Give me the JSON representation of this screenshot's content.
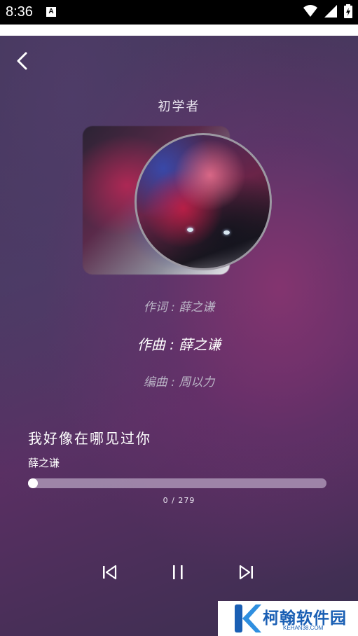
{
  "status_bar": {
    "time": "8:36",
    "notification_icon": "a-icon",
    "icons": [
      "wifi-icon",
      "signal-icon",
      "battery-icon"
    ]
  },
  "player": {
    "album_title": "初学者",
    "lyricist": "作词 : 薛之谦",
    "composer": "作曲 : 薛之谦",
    "arranger": "编曲 : 周以力",
    "song_title": "我好像在哪见过你",
    "artist": "薛之谦",
    "progress": {
      "current": 0,
      "total": 279,
      "label": "0 / 279"
    },
    "controls": [
      "previous-icon",
      "pause-icon",
      "next-icon"
    ]
  },
  "watermark": {
    "name": "柯翰软件园",
    "domain": "KEHAN38.COM"
  },
  "colors": {
    "background_start": "#3e3756",
    "background_accent": "#863470",
    "watermark_blue": "#1a5fb4"
  }
}
